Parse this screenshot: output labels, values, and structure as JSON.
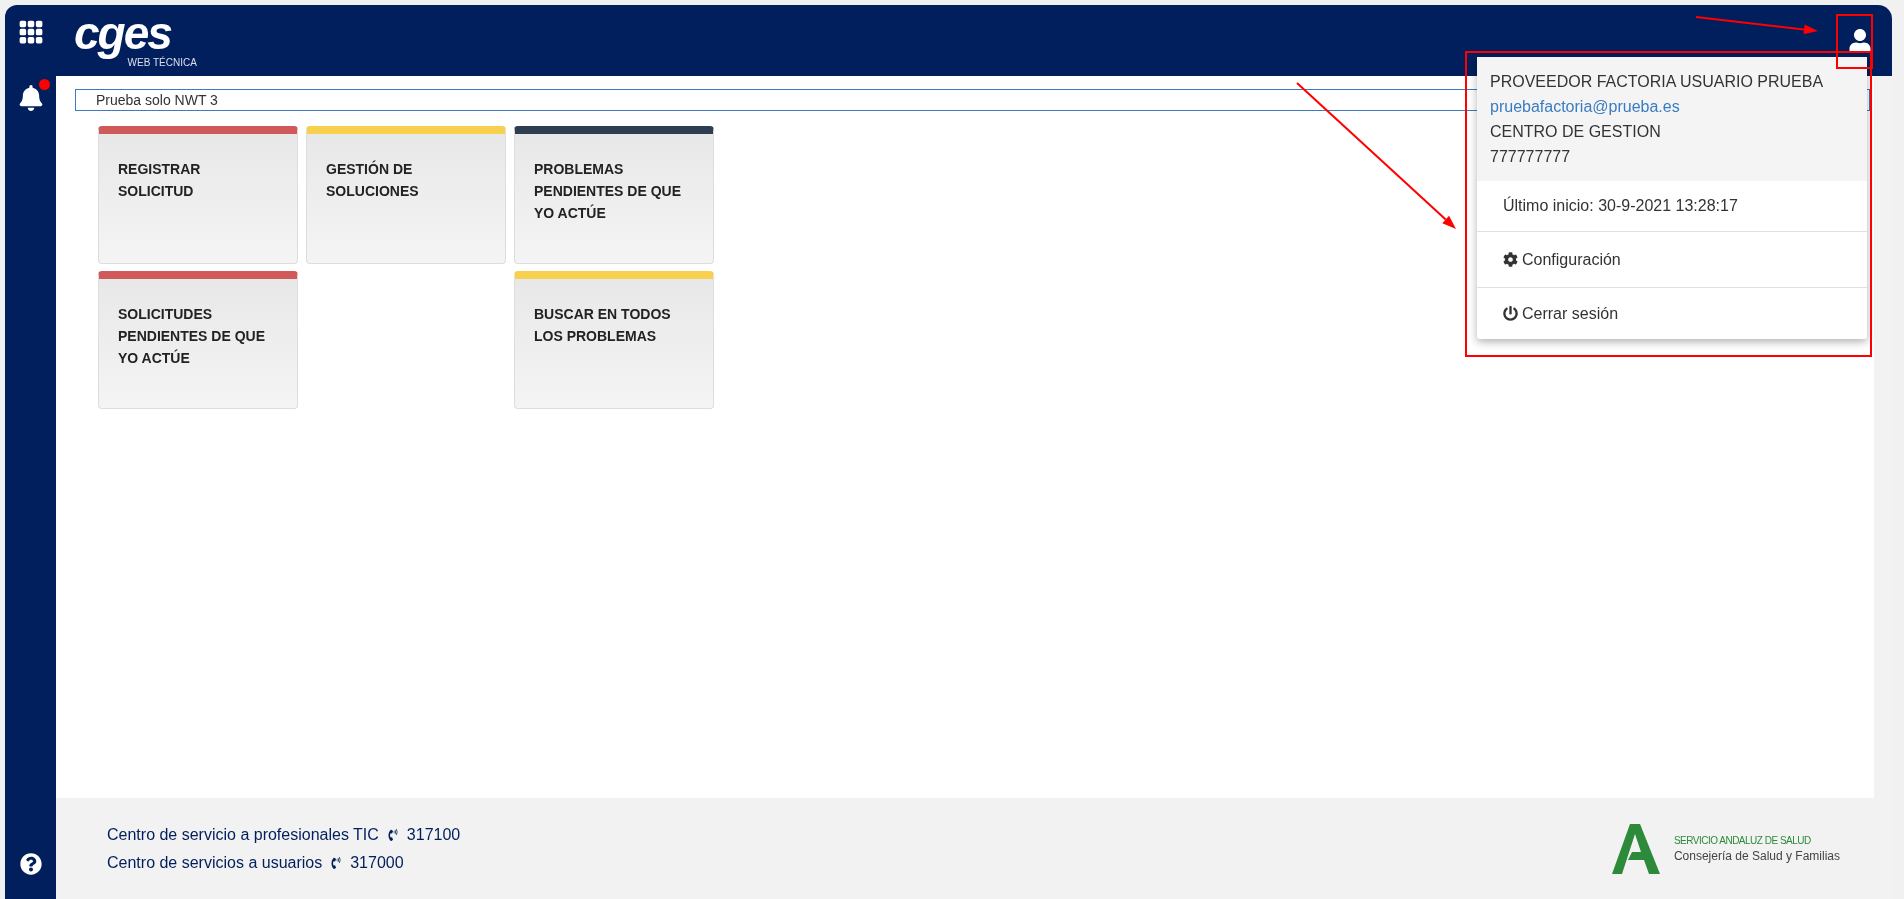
{
  "header": {
    "logo": {
      "wordmark": "cges",
      "subtitle": "WEB TÉCNICA"
    },
    "notifications": {
      "unread": true
    }
  },
  "search": {
    "value": "Prueba solo NWT 3"
  },
  "tile_rows": [
    {
      "tiles": [
        {
          "kind": "tile",
          "label": "REGISTRAR SOLICITUD",
          "color": "#d05a5a"
        },
        {
          "kind": "tile",
          "label": "GESTIÓN DE SOLUCIONES",
          "color": "#f8d04f"
        },
        {
          "kind": "tile",
          "label": "PROBLEMAS PENDIENTES DE QUE YO ACTÚE",
          "color": "#2c3e50"
        }
      ]
    },
    {
      "tiles": [
        {
          "kind": "tile",
          "label": "SOLICITUDES PENDIENTES DE QUE YO ACTÚE",
          "color": "#d05a5a"
        },
        {
          "kind": "empty"
        },
        {
          "kind": "tile",
          "label": "BUSCAR EN TODOS LOS PROBLEMAS",
          "color": "#f8d04f"
        }
      ]
    }
  ],
  "user_menu": {
    "name": "PROVEEDOR FACTORIA USUARIO PRUEBA",
    "email": "pruebafactoria@prueba.es",
    "center": "CENTRO DE GESTION",
    "phone": "777777777",
    "last_login": "Último inicio: 30-9-2021 13:28:17",
    "items": [
      {
        "kind": "gear",
        "label": "Configuración"
      },
      {
        "kind": "power",
        "label": "Cerrar sesión"
      }
    ]
  },
  "footer": {
    "contacts": [
      {
        "label": "Centro de servicio a profesionales TIC",
        "phone": "317100"
      },
      {
        "label": "Centro de servicios a usuarios",
        "phone": "317000"
      }
    ],
    "brand": {
      "title": "SERVICIO ANDALUZ DE SALUD",
      "subtitle": "Consejería de Salud y Familias"
    }
  }
}
